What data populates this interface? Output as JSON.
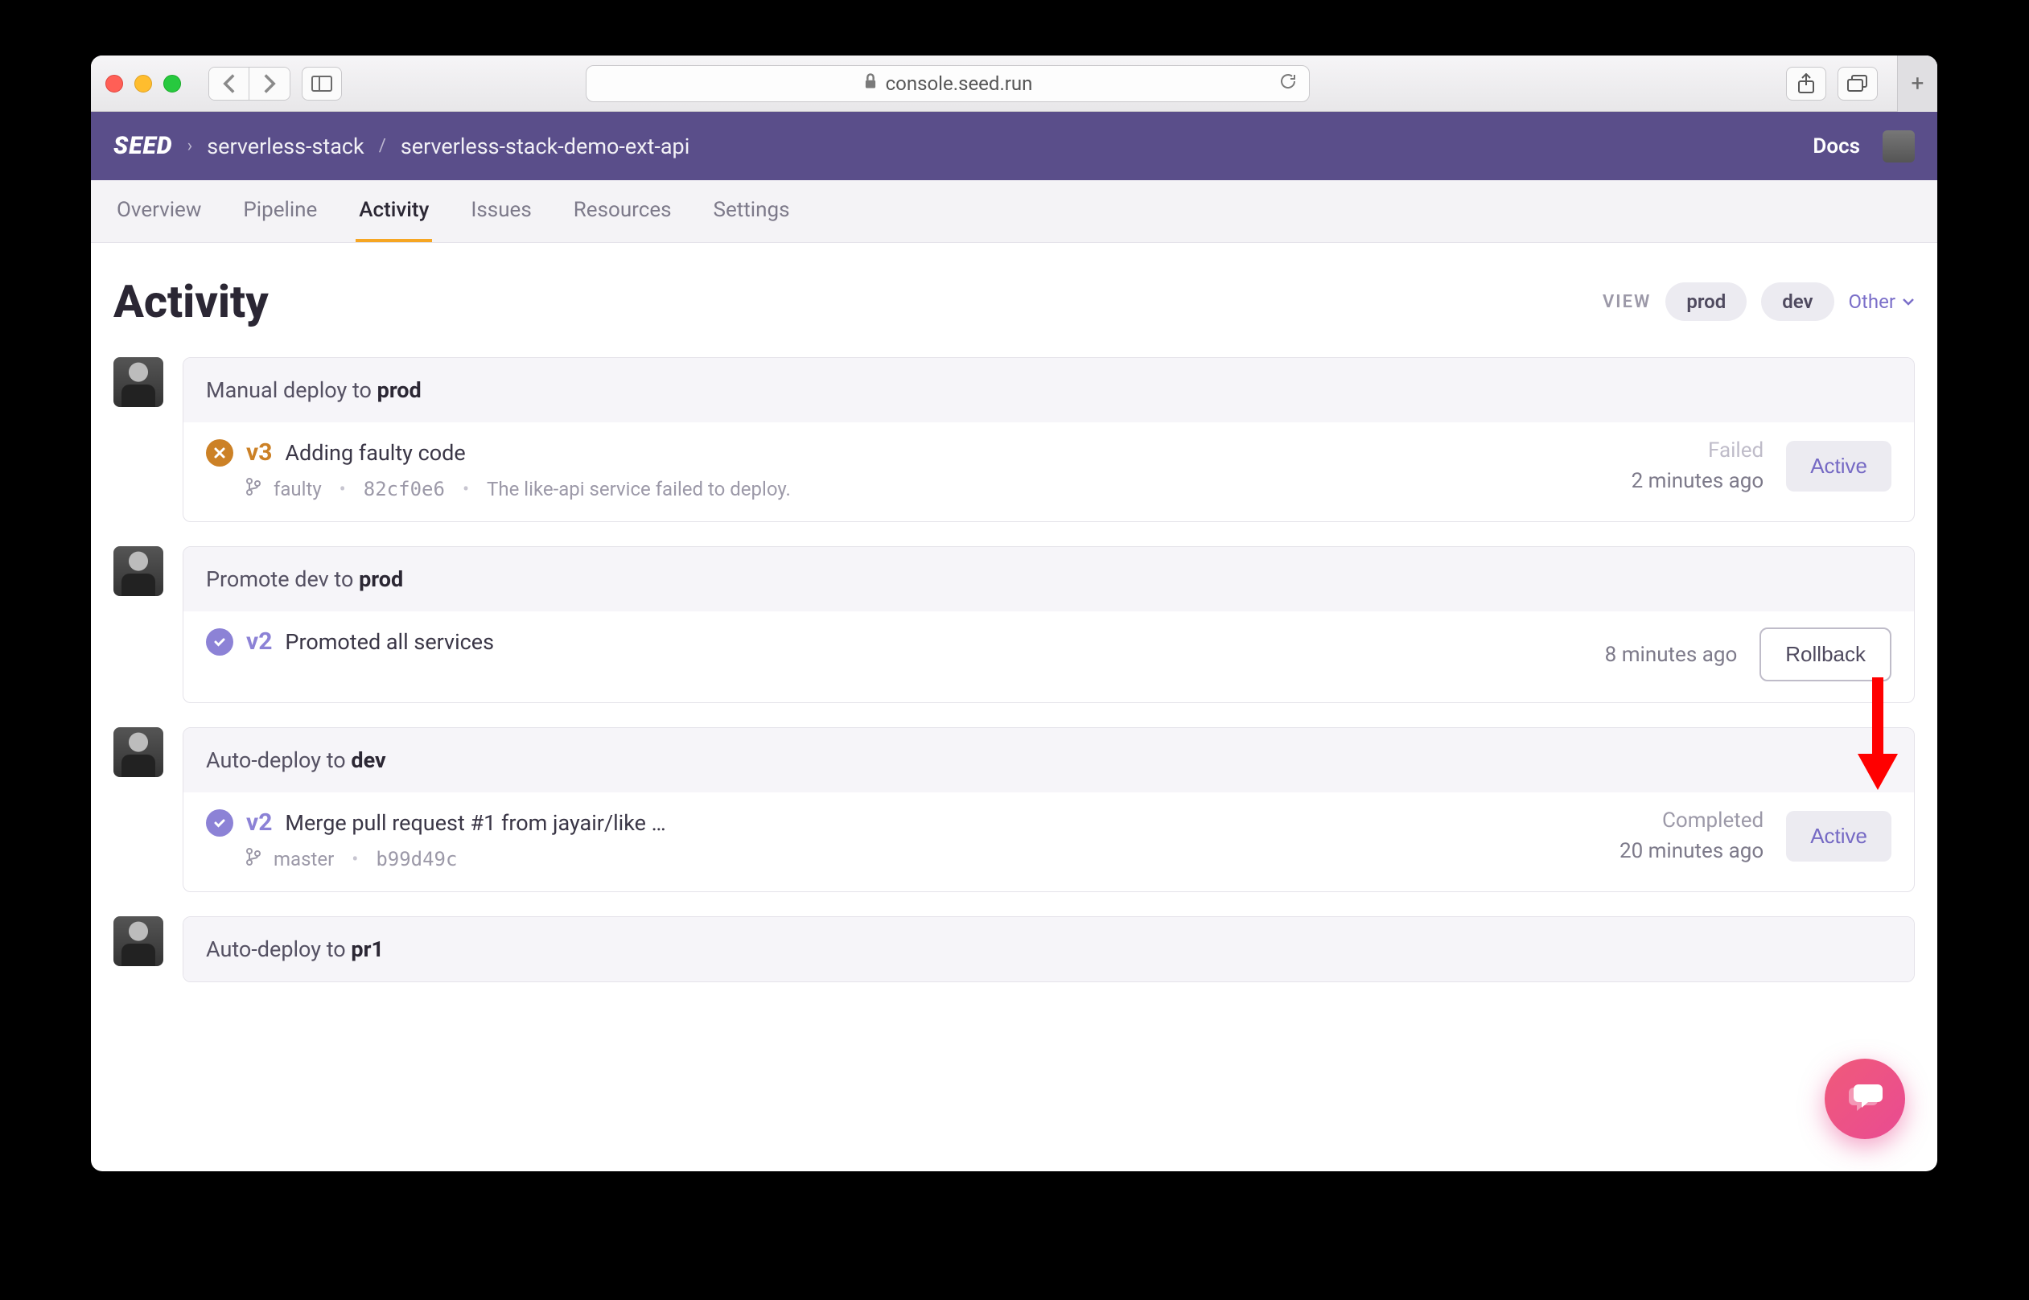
{
  "browser": {
    "url": "console.seed.run"
  },
  "header": {
    "logo": "SEED",
    "crumb1": "serverless-stack",
    "crumb2": "serverless-stack-demo-ext-api",
    "docs": "Docs"
  },
  "tabs": {
    "overview": "Overview",
    "pipeline": "Pipeline",
    "activity": "Activity",
    "issues": "Issues",
    "resources": "Resources",
    "settings": "Settings"
  },
  "page": {
    "title": "Activity",
    "viewLabel": "VIEW",
    "pillProd": "prod",
    "pillDev": "dev",
    "otherLabel": "Other"
  },
  "items": [
    {
      "head_prefix": "Manual deploy to ",
      "head_bold": "prod",
      "status": "fail",
      "version": "v3",
      "message": "Adding faulty code",
      "branch": "faulty",
      "commit": "82cf0e6",
      "detail": "The like-api service failed to deploy.",
      "statusText": "Failed",
      "time": "2 minutes ago",
      "action": "Active",
      "actionType": "active"
    },
    {
      "head_prefix": "Promote dev to ",
      "head_bold": "prod",
      "status": "ok",
      "version": "v2",
      "message": "Promoted all services",
      "branch": "",
      "commit": "",
      "detail": "",
      "statusText": "",
      "time": "8 minutes ago",
      "action": "Rollback",
      "actionType": "rollback"
    },
    {
      "head_prefix": "Auto-deploy to ",
      "head_bold": "dev",
      "status": "ok",
      "version": "v2",
      "message": "Merge pull request #1 from jayair/like …",
      "branch": "master",
      "commit": "b99d49c",
      "detail": "",
      "statusText": "Completed",
      "time": "20 minutes ago",
      "action": "Active",
      "actionType": "active"
    },
    {
      "head_prefix": "Auto-deploy to ",
      "head_bold": "pr1",
      "status": "",
      "version": "",
      "message": "",
      "branch": "",
      "commit": "",
      "detail": "",
      "statusText": "",
      "time": "",
      "action": "",
      "actionType": ""
    }
  ]
}
